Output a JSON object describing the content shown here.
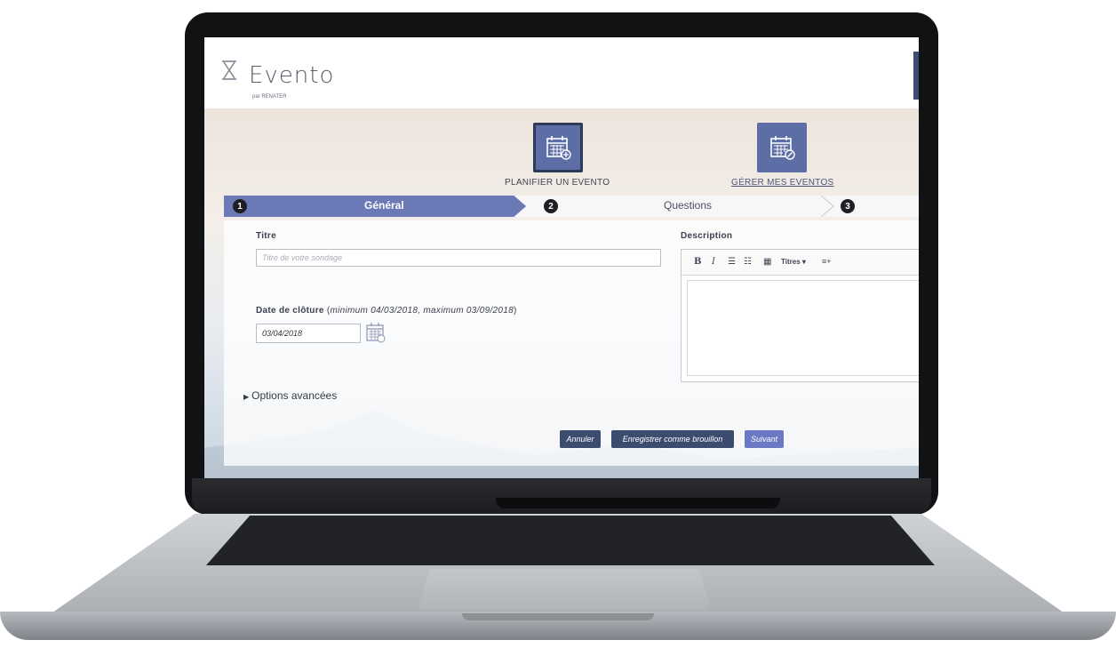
{
  "app": {
    "logo_text": "Evento",
    "logo_subtext": "par RENATER"
  },
  "actions": {
    "plan_label": "PLANIFIER UN EVENTO",
    "manage_label": "GÉRER MES EVENTOS",
    "plan_icon": "calendar-plus-icon",
    "manage_icon": "calendar-edit-icon"
  },
  "steps": [
    {
      "number": "1",
      "label": "Général",
      "active": true
    },
    {
      "number": "2",
      "label": "Questions",
      "active": false
    },
    {
      "number": "3",
      "label": "",
      "active": false
    }
  ],
  "form": {
    "title_label": "Titre",
    "title_placeholder": "Titre de votre sondage",
    "title_value": "",
    "closing_label": "Date de clôture",
    "closing_hint_open": " (",
    "closing_hint": "minimum 04/03/2018, maximum 03/09/2018",
    "closing_hint_close": ")",
    "closing_value": "03/04/2018",
    "advanced_label": "Options avancées",
    "description_label": "Description",
    "toolbar": {
      "bold": "B",
      "italic": "I",
      "bullets": "☰",
      "numbered": "☷",
      "table": "▦",
      "headings": "Titres ▾",
      "more": "≡+"
    }
  },
  "buttons": {
    "cancel": "Annuler",
    "save_draft": "Enregistrer comme brouillon",
    "next": "Suivant"
  },
  "colors": {
    "accent": "#6b79b7",
    "primary_dark": "#3b4c6f"
  }
}
